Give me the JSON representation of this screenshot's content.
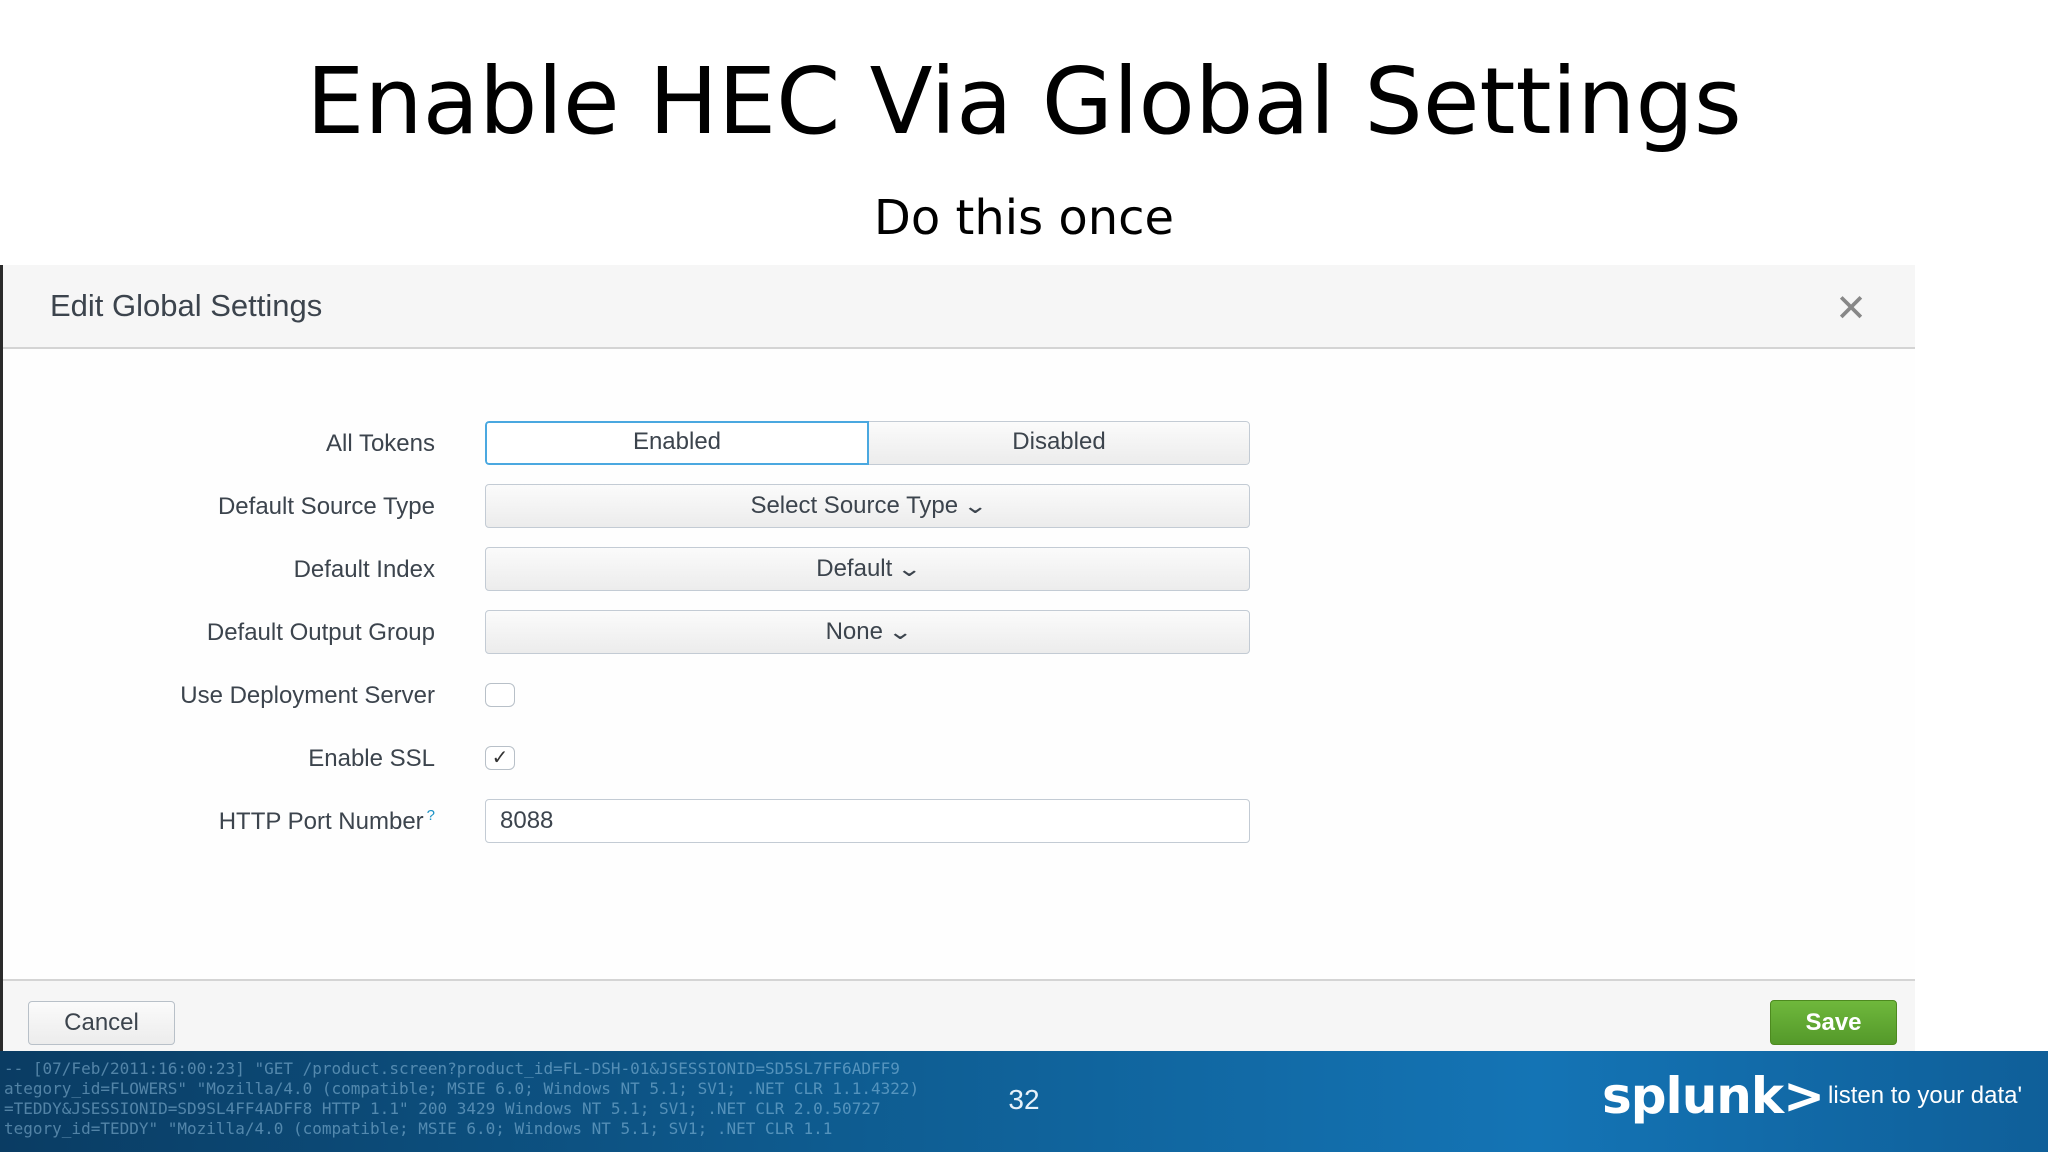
{
  "slide": {
    "title": "Enable HEC Via Global Settings",
    "subtitle": "Do this once",
    "page_number": "32"
  },
  "dialog": {
    "title": "Edit Global Settings",
    "close_icon": "close-icon",
    "fields": {
      "all_tokens": {
        "label": "All Tokens",
        "options": [
          "Enabled",
          "Disabled"
        ],
        "selected": "Enabled"
      },
      "default_source_type": {
        "label": "Default Source Type",
        "value": "Select Source Type"
      },
      "default_index": {
        "label": "Default Index",
        "value": "Default"
      },
      "default_output_group": {
        "label": "Default Output Group",
        "value": "None"
      },
      "use_deployment_server": {
        "label": "Use Deployment Server",
        "checked": false
      },
      "enable_ssl": {
        "label": "Enable SSL",
        "checked": true
      },
      "http_port_number": {
        "label": "HTTP Port Number",
        "help": "?",
        "value": "8088"
      }
    },
    "footer": {
      "cancel_label": "Cancel",
      "save_label": "Save"
    }
  },
  "banner": {
    "brand": "splunk>",
    "tagline": "listen to your data'",
    "log_lines": [
      "-- [07/Feb/2011:16:00:23] \"GET /product.screen?product_id=FL-DSH-01&JSESSIONID=SD5SL7FF6ADFF9",
      "ategory_id=FLOWERS\" \"Mozilla/4.0 (compatible; MSIE 6.0; Windows NT 5.1; SV1; .NET CLR 1.1.4322)",
      "=TEDDY&JSESSIONID=SD9SL4FF4ADFF8 HTTP 1.1\" 200 3429 Windows NT 5.1; SV1; .NET CLR 2.0.50727",
      "tegory_id=TEDDY\" \"Mozilla/4.0 (compatible; MSIE 6.0; Windows NT 5.1; SV1; .NET CLR 1.1"
    ],
    "colors": {
      "accent": "#1474b5",
      "save": "#5fa832",
      "focus": "#4aa8e0"
    }
  }
}
